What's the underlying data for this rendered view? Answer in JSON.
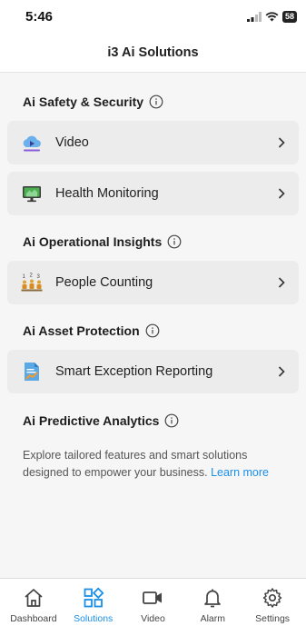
{
  "status_bar": {
    "time": "5:46",
    "battery": "58"
  },
  "header": {
    "title": "i3 Ai Solutions"
  },
  "sections": [
    {
      "heading": "Ai Safety & Security",
      "items": [
        {
          "label": "Video",
          "icon": "video-cloud-icon"
        },
        {
          "label": "Health Monitoring",
          "icon": "monitor-icon"
        }
      ]
    },
    {
      "heading": "Ai Operational Insights",
      "items": [
        {
          "label": "People Counting",
          "icon": "people-counting-icon"
        }
      ]
    },
    {
      "heading": "Ai Asset Protection",
      "items": [
        {
          "label": "Smart Exception Reporting",
          "icon": "report-icon"
        }
      ]
    },
    {
      "heading": "Ai Predictive Analytics",
      "items": []
    }
  ],
  "description": {
    "text": "Explore tailored features and smart solutions designed to empower your business.",
    "link": "Learn more"
  },
  "tabs": [
    {
      "label": "Dashboard",
      "icon": "home-icon",
      "active": false
    },
    {
      "label": "Solutions",
      "icon": "solutions-grid-icon",
      "active": true
    },
    {
      "label": "Video",
      "icon": "camera-icon",
      "active": false
    },
    {
      "label": "Alarm",
      "icon": "bell-icon",
      "active": false
    },
    {
      "label": "Settings",
      "icon": "gear-icon",
      "active": false
    }
  ],
  "colors": {
    "accent": "#1a8fe8",
    "card_bg": "#ececec",
    "page_bg": "#f6f6f6"
  }
}
